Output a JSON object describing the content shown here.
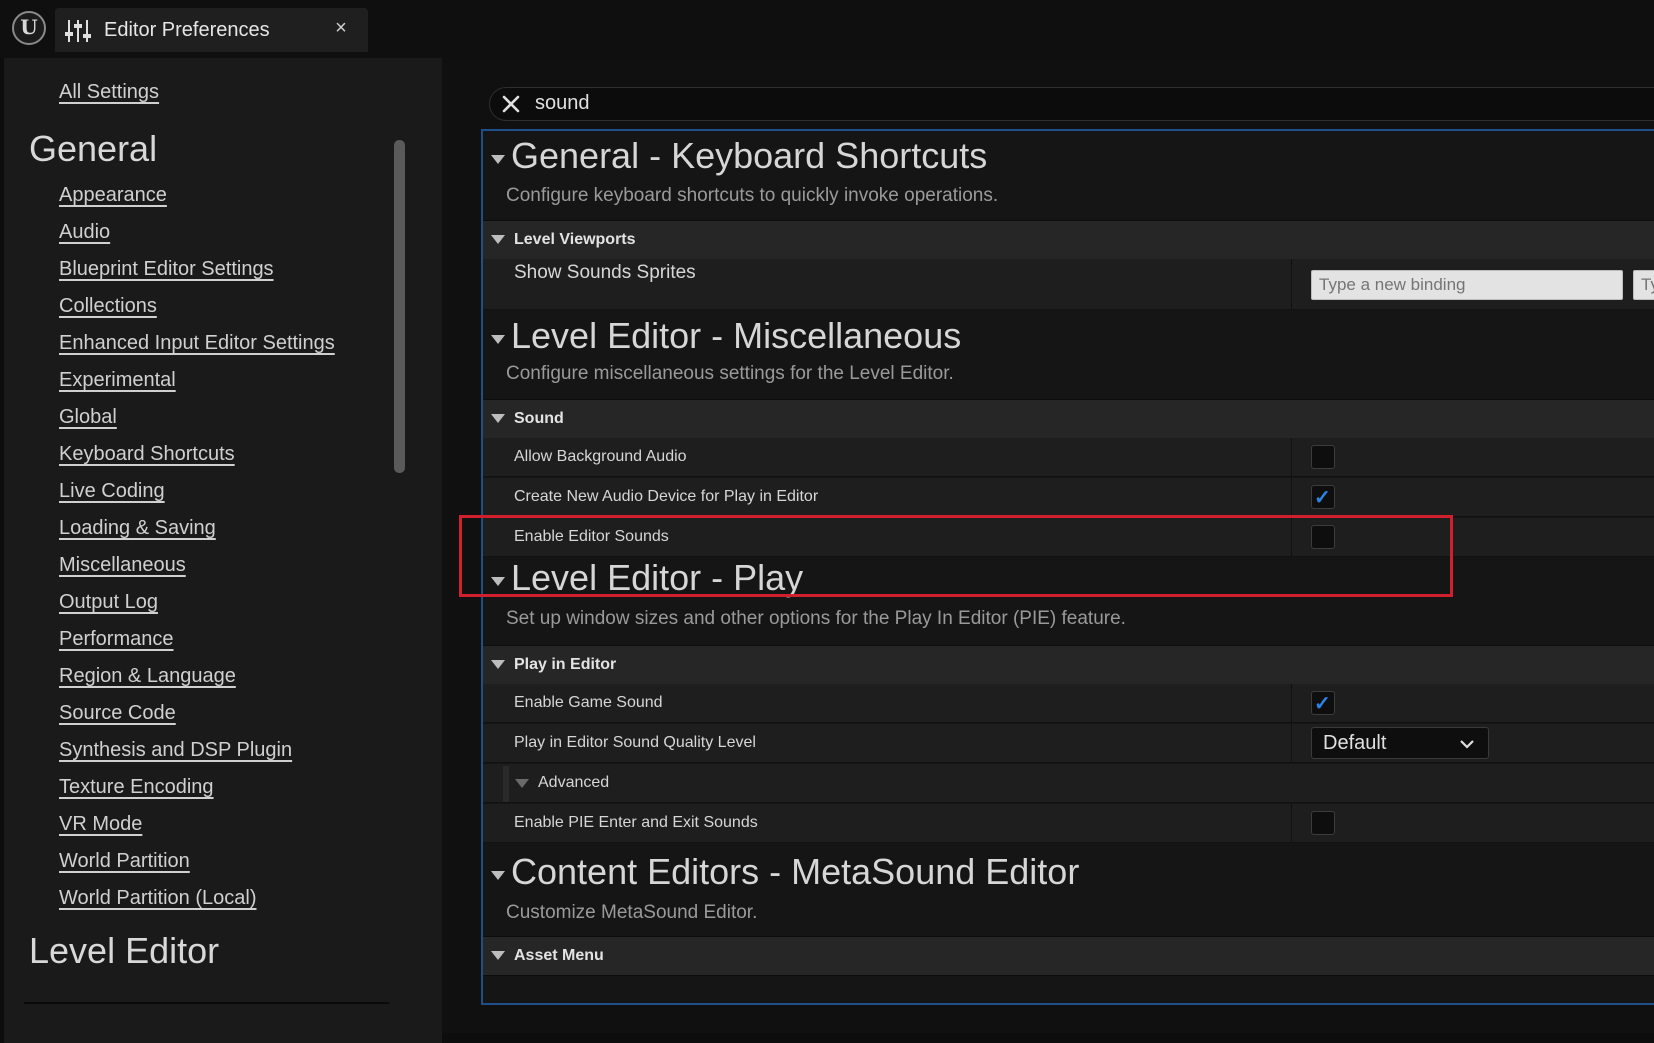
{
  "window": {
    "tab_title": "Editor Preferences",
    "close_glyph": "×",
    "logo_glyph": "U"
  },
  "nav": {
    "all_settings": "All Settings",
    "category_general": "General",
    "items": [
      "Appearance",
      "Audio",
      "Blueprint Editor Settings",
      "Collections",
      "Enhanced Input Editor Settings",
      "Experimental",
      "Global",
      "Keyboard Shortcuts",
      "Live Coding",
      "Loading & Saving",
      "Miscellaneous",
      "Output Log",
      "Performance",
      "Region & Language",
      "Source Code",
      "Synthesis and DSP Plugin",
      "Texture Encoding",
      "VR Mode",
      "World Partition",
      "World Partition (Local)"
    ],
    "category_next": "Level Editor"
  },
  "search": {
    "value": "sound"
  },
  "sections": {
    "keyboard": {
      "title": "General - Keyboard Shortcuts",
      "desc": "Configure keyboard shortcuts to quickly invoke operations.",
      "category": "Level Viewports",
      "property": "Show Sounds Sprites",
      "binding_placeholder": "Type a new binding",
      "binding_placeholder_2": "Ty"
    },
    "misc": {
      "title": "Level Editor - Miscellaneous",
      "desc": "Configure miscellaneous settings for the Level Editor.",
      "category": "Sound",
      "props": [
        {
          "label": "Allow Background Audio",
          "checked": false
        },
        {
          "label": "Create New Audio Device for Play in Editor",
          "checked": true
        },
        {
          "label": "Enable Editor Sounds",
          "checked": false
        }
      ]
    },
    "play": {
      "title": "Level Editor - Play",
      "desc": "Set up window sizes and other options for the Play In Editor (PIE) feature.",
      "category": "Play in Editor",
      "enable_game_sound": "Enable Game Sound",
      "enable_game_sound_checked": true,
      "sound_quality": "Play in Editor Sound Quality Level",
      "sound_quality_value": "Default",
      "advanced": "Advanced",
      "enter_exit": "Enable PIE Enter and Exit Sounds",
      "enter_exit_checked": false
    },
    "metasound": {
      "title": "Content Editors - MetaSound Editor",
      "desc": "Customize MetaSound Editor.",
      "category": "Asset Menu"
    }
  },
  "theme": {
    "accent": "#2b84e6",
    "highlight": "#d0202d",
    "selection_border": "#1e4f8a"
  },
  "icons": [
    "unreal-logo-icon",
    "sliders-icon",
    "close-icon",
    "clear-search-icon",
    "collapse-triangle-icon",
    "checkmark-icon",
    "chevron-down-icon"
  ]
}
